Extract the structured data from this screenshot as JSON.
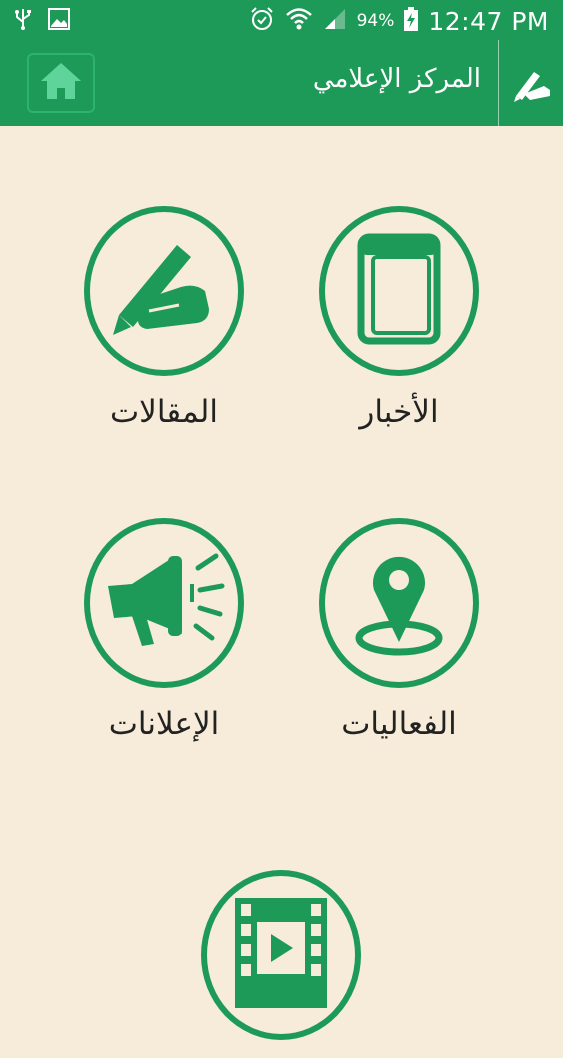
{
  "status_bar": {
    "battery_percent": "94%",
    "time": "12:47 PM"
  },
  "app_bar": {
    "title": "المركز الإعلامي"
  },
  "tiles": [
    {
      "label": "الأخبار",
      "icon": "book-icon"
    },
    {
      "label": "المقالات",
      "icon": "writing-hand-icon"
    },
    {
      "label": "الفعاليات",
      "icon": "location-pin-icon"
    },
    {
      "label": "الإعلانات",
      "icon": "megaphone-icon"
    },
    {
      "label": "",
      "icon": "video-film-icon"
    }
  ],
  "colors": {
    "primary": "#1e9a58",
    "background": "#f6ecd9"
  }
}
